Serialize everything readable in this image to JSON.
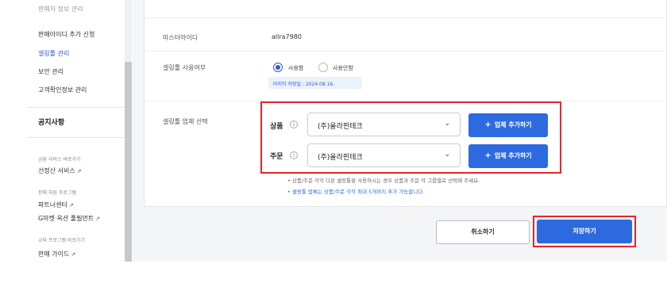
{
  "sidebar": {
    "cut_item": "판매자 정보 관리",
    "items": [
      {
        "label": "판매아이디 추가 신청"
      },
      {
        "label": "셀링툴 관리",
        "active": true
      },
      {
        "label": "보안 관리"
      },
      {
        "label": "고객확인정보 관리"
      }
    ],
    "notice_section": "공지사항",
    "groups": [
      {
        "title": "금융 서비스 바로가기",
        "links": [
          "선정산 서비스"
        ]
      },
      {
        "title": "판매 지원 프로그램",
        "links": [
          "파트너센터",
          "G마켓·옥션 풀필먼트"
        ]
      },
      {
        "title": "교육 프로그램 바로가기",
        "links": [
          "판매 가이드"
        ]
      }
    ]
  },
  "form": {
    "master_id_label": "마스터아이디",
    "master_id_value": "allra7980",
    "usage_label": "셀링툴 사용여부",
    "radio_use": "사용함",
    "radio_not_use": "사용안함",
    "last_changed": "마지막 저장일 : 2024.08.16.",
    "vendor_label": "셀링툴 업체 선택",
    "rows": [
      {
        "label": "상품",
        "selected": "(주)올라핀테크",
        "add_button": "업체 추가하기"
      },
      {
        "label": "주문",
        "selected": "(주)올라핀테크",
        "add_button": "업체 추가하기"
      }
    ],
    "notes": [
      "상품/주문 각각 다른 셀링툴을 사용하시는 경우 상품과 주문 각 그룹별로 선택해 주세요.",
      "셀링툴 업체는 상품/주문 각각 최대 5개까지 추가 가능합니다."
    ]
  },
  "actions": {
    "cancel": "취소하기",
    "save": "저장하기"
  },
  "colors": {
    "accent": "#2d6ae0",
    "highlight": "#e8242d"
  },
  "icons": {
    "external_link": "external-link-icon",
    "info": "info-icon",
    "chevron": "chevron-down-icon",
    "plus": "plus-icon"
  }
}
